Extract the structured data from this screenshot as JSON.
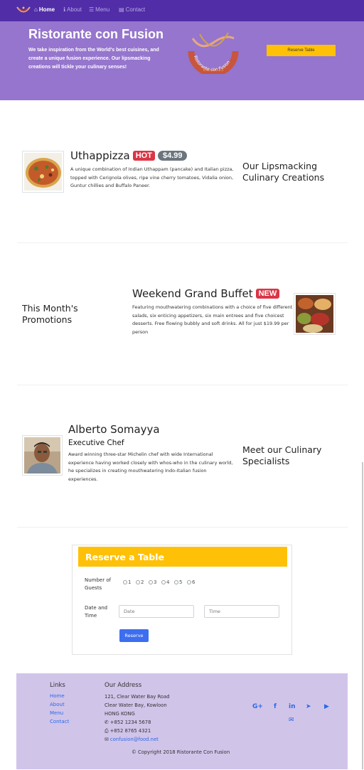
{
  "nav": {
    "items": [
      {
        "label": "Home",
        "icon": "home-icon",
        "glyph": "⌂",
        "active": true
      },
      {
        "label": "About",
        "icon": "info-icon",
        "glyph": "ℹ",
        "active": false
      },
      {
        "label": "Menu",
        "icon": "list-icon",
        "glyph": "☰",
        "active": false
      },
      {
        "label": "Contact",
        "icon": "address-card-icon",
        "glyph": "▤",
        "active": false
      }
    ]
  },
  "jumbotron": {
    "title": "Ristorante con Fusion",
    "text": "We take inspiration from the World's best cuisines, and create a unique fusion experience. Our lipsmacking creations will tickle your culinary senses!",
    "logo_text": "Ristorante con Fusion",
    "logo_est": "Est. 2013",
    "reserve_label": "Reserve Table"
  },
  "dish": {
    "name": "Uthappizza",
    "label": "HOT",
    "price": "$4.99",
    "description": "A unique combination of Indian Uthappam (pancake) and Italian pizza, topped with Cerignola olives, ripe vine cherry tomatoes, Vidalia onion, Guntur chillies and Buffalo Paneer.",
    "side_heading": "Our Lipsmacking Culinary Creations"
  },
  "promotion": {
    "side_heading": "This Month's Promotions",
    "name": "Weekend Grand Buffet",
    "label": "NEW",
    "description": "Featuring mouthwatering combinations with a choice of five different salads, six enticing appetizers, six main entrees and five choicest desserts. Free flowing bubbly and soft drinks. All for just $19.99 per person"
  },
  "leader": {
    "name": "Alberto Somayya",
    "designation": "Executive Chef",
    "description": "Award winning three-star Michelin chef with wide International experience having worked closely with whos-who in the culinary world, he specializes in creating mouthwatering Indo-Italian fusion experiences.",
    "side_heading": "Meet our Culinary Specialists"
  },
  "reserve": {
    "title": "Reserve a Table",
    "guests_label": "Number of Guests",
    "guest_options": [
      "1",
      "2",
      "3",
      "4",
      "5",
      "6"
    ],
    "datetime_label": "Date and Time",
    "date_placeholder": "Date",
    "time_placeholder": "Time",
    "submit_label": "Reserve"
  },
  "footer": {
    "links_heading": "Links",
    "links": [
      "Home",
      "About",
      "Menu",
      "Contact"
    ],
    "address_heading": "Our Address",
    "address_lines": [
      "121, Clear Water Bay Road",
      "Clear Water Bay, Kowloon",
      "HONG KONG"
    ],
    "phone": "+852 1234 5678",
    "fax": "+852 8765 4321",
    "email": "confusion@food.net",
    "social": [
      {
        "icon": "google-plus-icon",
        "glyph": "G+"
      },
      {
        "icon": "facebook-icon",
        "glyph": "f"
      },
      {
        "icon": "linkedin-icon",
        "glyph": "in"
      },
      {
        "icon": "twitter-icon",
        "glyph": "🐦"
      },
      {
        "icon": "youtube-icon",
        "glyph": "▶"
      }
    ],
    "mail_icon": "envelope-icon",
    "copyright": "© Copyright 2018 Ristorante Con Fusion"
  },
  "colors": {
    "navbar": "#512da8",
    "jumbotron": "#9575cd",
    "footer": "#d1c4e9",
    "accent": "#ffc107",
    "badge": "#dc3545",
    "link": "#2a6ae8"
  }
}
